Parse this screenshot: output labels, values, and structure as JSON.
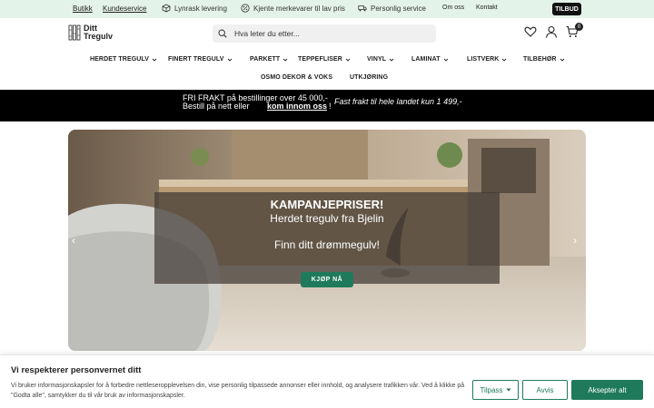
{
  "topbar": {
    "butikk": "Butikk",
    "kundeservice": "Kundeservice",
    "usp1": "Lynrask levering",
    "usp2": "Kjente merkevarer til lav pris",
    "usp3": "Personlig service",
    "om_oss": "Om oss",
    "kontakt": "Kontakt",
    "tilbud": "TILBUD"
  },
  "header": {
    "logo_line1": "Ditt",
    "logo_line2": "Tregulv",
    "search_placeholder": "Hva leter du etter...",
    "cart_count": "0"
  },
  "nav": {
    "items": [
      "HERDET TREGULV",
      "FINERT TREGULV",
      "PARKETT",
      "TEPPEFLISER",
      "VINYL",
      "LAMINAT",
      "LISTVERK",
      "TILBEHØR",
      "OSMO DEKOR & VOKS",
      "UTKJØRING"
    ]
  },
  "promo": {
    "line1": "FRI FRAKT på bestillinger over 45 000,-",
    "line2": "Bestill på nett eller",
    "link": "kom innom oss",
    "excl": "!",
    "italic": "Fast frakt til hele landet kun 1 499,-"
  },
  "hero": {
    "heading": "KAMPANJEPRISER!",
    "sub": "Herdet tregulv fra Bjelin",
    "tagline": "Finn ditt drømmegulv!",
    "button": "KJØP NÅ",
    "prev": "‹",
    "next": "›"
  },
  "cookie": {
    "title": "Vi respekterer personvernet ditt",
    "text": "Vi bruker informasjonskapsler for å forbedre nettleseropplevelsen din, vise personlig tilpassede annonser eller innhold, og analysere trafikken vår. Ved å klikke på \"Godta alle\", samtykker du til vår bruk av informasjonskapsler.",
    "customize": "Tilpass",
    "reject": "Avvis",
    "accept": "Aksepter alt"
  },
  "colors": {
    "accent": "#1f7a5c",
    "topbar_bg": "#e4f3e9",
    "promo_bg": "#000000"
  }
}
